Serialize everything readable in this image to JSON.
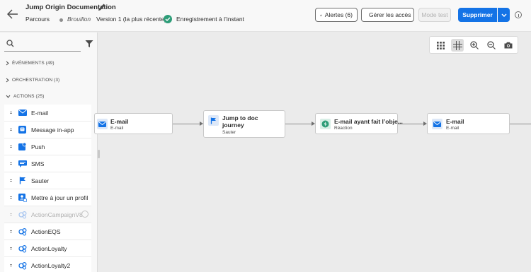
{
  "header": {
    "title": "Jump Origin Documentation",
    "breadcrumb": "Parcours",
    "status": "Brouillon",
    "version": "Version 1 (la plus récente)",
    "saved": "Enregistrement à l’instant",
    "alerts_button": "Alertes (6)",
    "access_button": "Gérer les accès",
    "test_button": "Mode test",
    "delete_button": "Supprimer"
  },
  "sidebar": {
    "search_placeholder": "",
    "sections": [
      {
        "label": "ÉVÉNEMENTS (49)",
        "expanded": false
      },
      {
        "label": "ORCHESTRATION (3)",
        "expanded": false
      },
      {
        "label": "ACTIONS (25)",
        "expanded": true
      }
    ],
    "items": [
      {
        "label": "E-mail",
        "icon": "email-icon",
        "enabled": true
      },
      {
        "label": "Message in-app",
        "icon": "in-app-message-icon",
        "enabled": true
      },
      {
        "label": "Push",
        "icon": "push-icon",
        "enabled": true
      },
      {
        "label": "SMS",
        "icon": "sms-icon",
        "enabled": true
      },
      {
        "label": "Sauter",
        "icon": "jump-icon",
        "enabled": true
      },
      {
        "label": "Mettre à jour un profil",
        "icon": "update-profile-icon",
        "enabled": true
      },
      {
        "label": "ActionCampaignV8",
        "icon": "custom-action-icon",
        "enabled": false
      },
      {
        "label": "ActionEQS",
        "icon": "custom-action-icon",
        "enabled": true
      },
      {
        "label": "ActionLoyalty",
        "icon": "custom-action-icon",
        "enabled": true
      },
      {
        "label": "ActionLoyalty2",
        "icon": "custom-action-icon",
        "enabled": true
      }
    ]
  },
  "canvas": {
    "nodes": [
      {
        "title": "E-mail",
        "subtitle": "E-mail",
        "icon": "email-icon"
      },
      {
        "title": "Jump to doc journey",
        "title_line1": "Jump to doc",
        "title_line2": "journey",
        "subtitle": "Sauter",
        "icon": "jump-icon"
      },
      {
        "title": "E-mail ayant fait l’obje...",
        "subtitle": "Réaction",
        "icon": "reaction-icon"
      },
      {
        "title": "E-mail",
        "subtitle": "E-mail",
        "icon": "email-icon"
      }
    ]
  },
  "colors": {
    "accent": "#1473e6",
    "success": "#2d9d78",
    "icon_blue": "#1473e6"
  }
}
